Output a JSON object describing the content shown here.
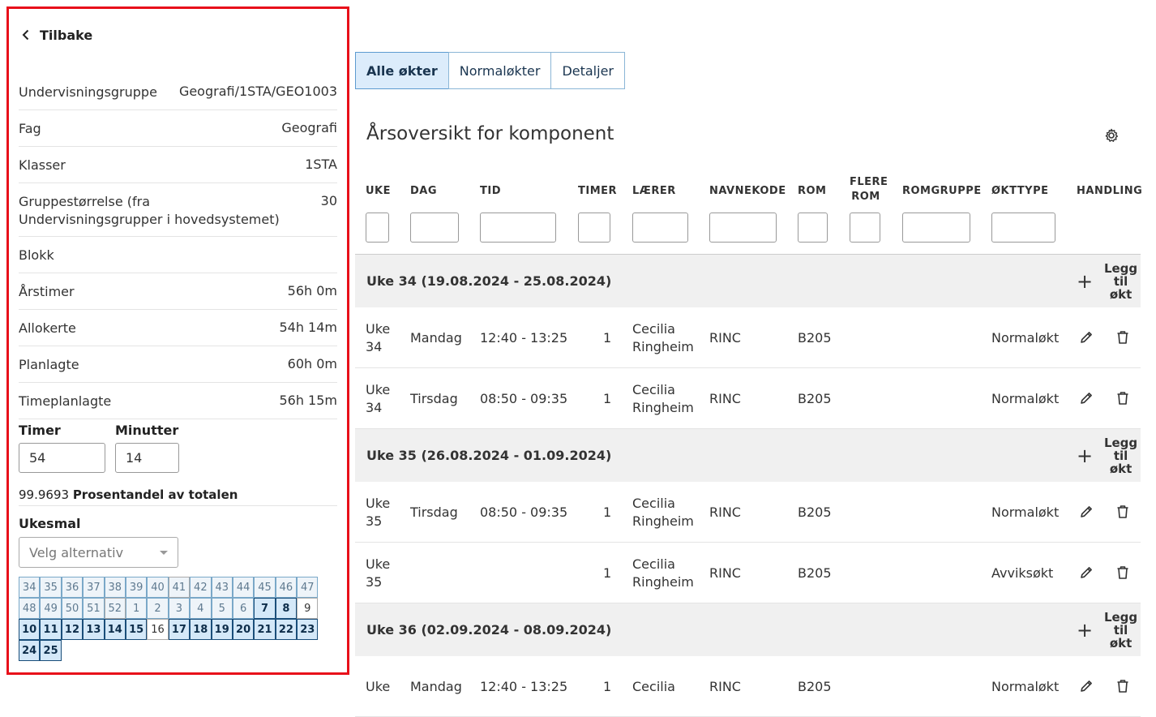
{
  "panel": {
    "back_label": "Tilbake",
    "info": [
      {
        "key": "Undervisningsgruppe",
        "value": "Geografi/1STA/GEO1003"
      },
      {
        "key": "Fag",
        "value": "Geografi"
      },
      {
        "key": "Klasser",
        "value": "1STA"
      },
      {
        "key": "Gruppestørrelse (fra Undervisningsgrupper i hovedsystemet)",
        "value": "30"
      },
      {
        "key": "Blokk",
        "value": ""
      },
      {
        "key": "Årstimer",
        "value": "56h 0m"
      },
      {
        "key": "Allokerte",
        "value": "54h 14m"
      },
      {
        "key": "Planlagte",
        "value": "60h 0m"
      },
      {
        "key": "Timeplanlagte",
        "value": "56h 15m"
      }
    ],
    "timer_label": "Timer",
    "timer_value": "54",
    "minutter_label": "Minutter",
    "minutter_value": "14",
    "percent_value": "99.9693",
    "percent_label": "Prosentandel av totalen",
    "ukesmal_label": "Ukesmal",
    "ukesmal_placeholder": "Velg alternativ",
    "weeks": [
      {
        "n": "34",
        "s": "past"
      },
      {
        "n": "35",
        "s": "past"
      },
      {
        "n": "36",
        "s": "past"
      },
      {
        "n": "37",
        "s": "past"
      },
      {
        "n": "38",
        "s": "past"
      },
      {
        "n": "39",
        "s": "past"
      },
      {
        "n": "40",
        "s": "past"
      },
      {
        "n": "41",
        "s": "pastoff"
      },
      {
        "n": "42",
        "s": "past"
      },
      {
        "n": "43",
        "s": "past"
      },
      {
        "n": "44",
        "s": "past"
      },
      {
        "n": "45",
        "s": "past"
      },
      {
        "n": "46",
        "s": "past"
      },
      {
        "n": "47",
        "s": "past"
      },
      {
        "n": "48",
        "s": "past"
      },
      {
        "n": "49",
        "s": "past"
      },
      {
        "n": "50",
        "s": "past"
      },
      {
        "n": "51",
        "s": "past"
      },
      {
        "n": "52",
        "s": "pastoff"
      },
      {
        "n": "1",
        "s": "past"
      },
      {
        "n": "2",
        "s": "past"
      },
      {
        "n": "3",
        "s": "past"
      },
      {
        "n": "4",
        "s": "past"
      },
      {
        "n": "5",
        "s": "past"
      },
      {
        "n": "6",
        "s": "past"
      },
      {
        "n": "7",
        "s": "on"
      },
      {
        "n": "8",
        "s": "on"
      },
      {
        "n": "9",
        "s": "off"
      },
      {
        "n": "10",
        "s": "on"
      },
      {
        "n": "11",
        "s": "on"
      },
      {
        "n": "12",
        "s": "on"
      },
      {
        "n": "13",
        "s": "on"
      },
      {
        "n": "14",
        "s": "on"
      },
      {
        "n": "15",
        "s": "on"
      },
      {
        "n": "16",
        "s": "off"
      },
      {
        "n": "17",
        "s": "on"
      },
      {
        "n": "18",
        "s": "on"
      },
      {
        "n": "19",
        "s": "on"
      },
      {
        "n": "20",
        "s": "on"
      },
      {
        "n": "21",
        "s": "on"
      },
      {
        "n": "22",
        "s": "on"
      },
      {
        "n": "23",
        "s": "on"
      },
      {
        "n": "24",
        "s": "on"
      },
      {
        "n": "25",
        "s": "on"
      }
    ]
  },
  "tabs": [
    "Alle økter",
    "Normaløkter",
    "Detaljer"
  ],
  "title": "Årsoversikt for komponent",
  "columns": [
    "UKE",
    "DAG",
    "TID",
    "TIMER",
    "LÆRER",
    "NAVNEKODE",
    "ROM",
    "FLERE ROM",
    "ROMGRUPPE",
    "ØKTTYPE",
    "HANDLING"
  ],
  "add_label_1": "Legg",
  "add_label_2": "til økt",
  "groups": [
    {
      "label": "Uke 34 (19.08.2024 - 25.08.2024)",
      "rows": [
        {
          "uke1": "Uke",
          "uke2": "34",
          "dag": "Mandag",
          "tid": "12:40 - 13:25",
          "timer": "1",
          "laerer1": "Cecilia",
          "laerer2": "Ringheim",
          "kode": "RINC",
          "rom": "B205",
          "type": "Normaløkt"
        },
        {
          "uke1": "Uke",
          "uke2": "34",
          "dag": "Tirsdag",
          "tid": "08:50 - 09:35",
          "timer": "1",
          "laerer1": "Cecilia",
          "laerer2": "Ringheim",
          "kode": "RINC",
          "rom": "B205",
          "type": "Normaløkt"
        }
      ]
    },
    {
      "label": "Uke 35 (26.08.2024 - 01.09.2024)",
      "rows": [
        {
          "uke1": "Uke",
          "uke2": "35",
          "dag": "Tirsdag",
          "tid": "08:50 - 09:35",
          "timer": "1",
          "laerer1": "Cecilia",
          "laerer2": "Ringheim",
          "kode": "RINC",
          "rom": "B205",
          "type": "Normaløkt"
        },
        {
          "uke1": "Uke",
          "uke2": "35",
          "dag": "",
          "tid": "",
          "timer": "1",
          "laerer1": "Cecilia",
          "laerer2": "Ringheim",
          "kode": "RINC",
          "rom": "B205",
          "type": "Avviksøkt"
        }
      ]
    },
    {
      "label": "Uke 36 (02.09.2024 - 08.09.2024)",
      "rows": [
        {
          "uke1": "Uke",
          "uke2": "",
          "dag": "Mandag",
          "tid": "12:40 - 13:25",
          "timer": "1",
          "laerer1": "Cecilia",
          "laerer2": "",
          "kode": "RINC",
          "rom": "B205",
          "type": "Normaløkt"
        }
      ]
    }
  ]
}
